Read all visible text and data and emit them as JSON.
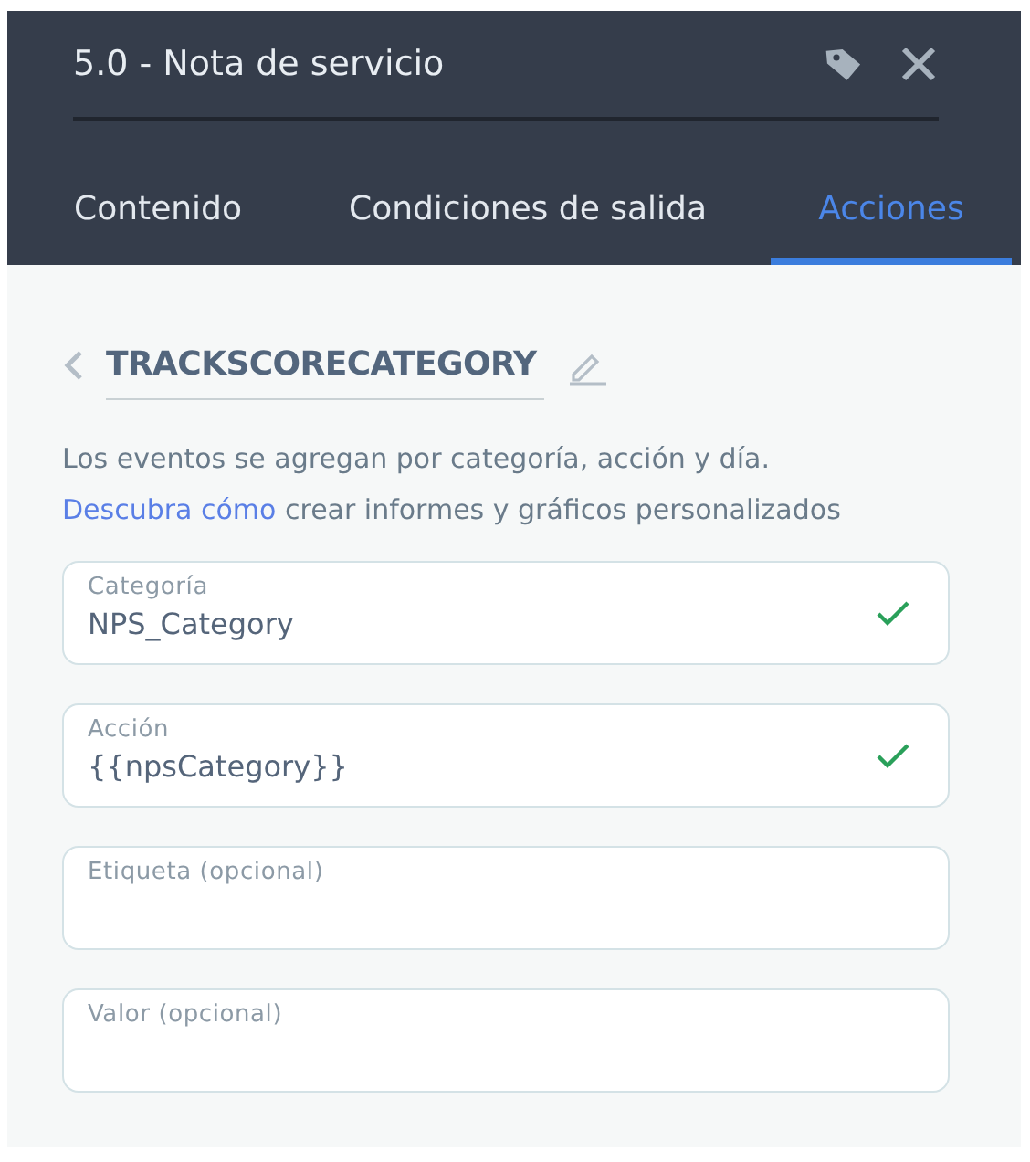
{
  "header": {
    "title": "5.0 - Nota de servicio"
  },
  "tabs": [
    {
      "label": "Contenido",
      "selected": false
    },
    {
      "label": "Condiciones de salida",
      "selected": false
    },
    {
      "label": "Acciones",
      "selected": true
    }
  ],
  "event": {
    "name": "TRACKSCORECATEGORY",
    "description_before": "Los eventos se agregan por categoría, acción y día. ",
    "link": "Descubra cómo",
    "description_after": " crear informes y gráficos personalizados"
  },
  "fields": [
    {
      "label": "Categoría",
      "value": "NPS_Category",
      "valid": true
    },
    {
      "label": "Acción",
      "value": "{{npsCategory}}",
      "valid": true
    },
    {
      "label": "Etiqueta (opcional)",
      "valid": false
    },
    {
      "label": "Valor (opcional)",
      "valid": false
    }
  ]
}
